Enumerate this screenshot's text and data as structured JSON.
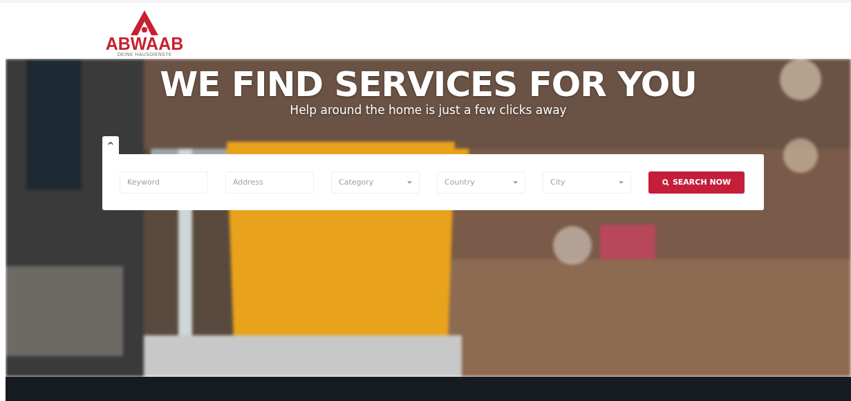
{
  "logo": {
    "name": "ABWAAB",
    "tagline": "DEINE HAUSDIENSTE"
  },
  "hero": {
    "kind": "picture",
    "title": "WE FIND SERVICES FOR YOU",
    "subtitle": "Help around the home is just a few clicks away"
  },
  "search": {
    "collapse_toggle": "^",
    "fields": [
      {
        "kind": "text",
        "placeholder": "Keyword"
      },
      {
        "kind": "text",
        "placeholder": "Address"
      },
      {
        "kind": "select",
        "placeholder": "Category"
      },
      {
        "kind": "select",
        "placeholder": "Country"
      },
      {
        "kind": "select",
        "placeholder": "City"
      }
    ],
    "button": "SEARCH NOW"
  }
}
